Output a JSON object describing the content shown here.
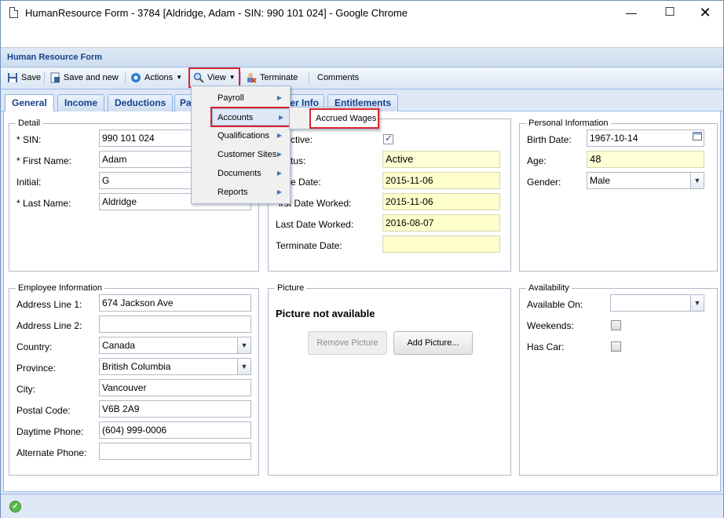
{
  "window": {
    "title": "HumanResource Form - 3784 [Aldridge, Adam - SIN: 990 101 024] - Google Chrome"
  },
  "form": {
    "header": "Human Resource Form"
  },
  "toolbar": {
    "save": "Save",
    "save_new": "Save and new",
    "actions": "Actions",
    "view": "View",
    "terminate": "Terminate",
    "comments": "Comments"
  },
  "tabs": [
    "General",
    "Income",
    "Deductions",
    "Pa",
    "er Info",
    "Entitlements"
  ],
  "menu": {
    "items": [
      "Payroll",
      "Accounts",
      "Qualifications",
      "Customer Sites",
      "Documents",
      "Reports"
    ],
    "submenu": "Accrued Wages"
  },
  "detail": {
    "legend": "Detail",
    "sin_label": "* SIN:",
    "sin": "990 101 024",
    "first_label": "* First Name:",
    "first": "Adam",
    "initial_label": "Initial:",
    "initial": "G",
    "last_label": "* Last Name:",
    "last": "Aldridge"
  },
  "status": {
    "active_label": "ctive:",
    "status_label": "tus:",
    "status_value": "Active",
    "date_label": "e Date:",
    "date_value": "2015-11-06",
    "first_worked_label": "irst Date Worked:",
    "first_worked": "2015-11-06",
    "last_worked_label": "Last Date Worked:",
    "last_worked": "2016-08-07",
    "terminate_label": "Terminate Date:",
    "terminate": ""
  },
  "personal": {
    "legend": "Personal Information",
    "birth_label": "Birth Date:",
    "birth": "1967-10-14",
    "age_label": "Age:",
    "age": "48",
    "gender_label": "Gender:",
    "gender": "Male"
  },
  "employee": {
    "legend": "Employee Information",
    "addr1_label": "Address Line 1:",
    "addr1": "674 Jackson Ave",
    "addr2_label": "Address Line 2:",
    "addr2": "",
    "country_label": "Country:",
    "country": "Canada",
    "province_label": "Province:",
    "province": "British Columbia",
    "city_label": "City:",
    "city": "Vancouver",
    "postal_label": "Postal Code:",
    "postal": "V6B 2A9",
    "phone_label": "Daytime Phone:",
    "phone": "(604) 999-0006",
    "alt_label": "Alternate Phone:",
    "alt": ""
  },
  "picture": {
    "legend": "Picture",
    "message": "Picture not available",
    "remove": "Remove Picture",
    "add": "Add Picture..."
  },
  "availability": {
    "legend": "Availability",
    "available_label": "Available On:",
    "available": "",
    "weekends_label": "Weekends:",
    "car_label": "Has Car:"
  }
}
